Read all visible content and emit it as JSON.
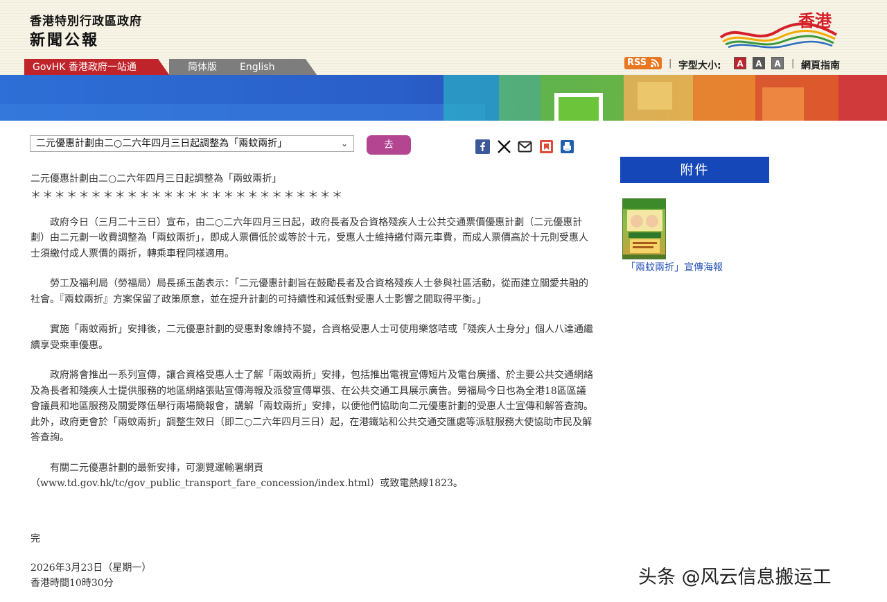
{
  "header": {
    "brand_line1": "香港特別行政區政府",
    "brand_line2": "新聞公報",
    "hk_brand": "香港",
    "nav": {
      "govhk": "GovHK 香港政府一站通",
      "simplified": "简体版",
      "english": "English"
    },
    "rss": "RSS",
    "font_size_label": "字型大小:",
    "font_size_options": [
      "A",
      "A",
      "A"
    ],
    "guide": "網頁指南"
  },
  "toolbar": {
    "select_value": "二元優惠計劃由二○二六年四月三日起調整為「兩蚊兩折」",
    "go_label": "去",
    "share_icons": [
      "facebook-icon",
      "x-icon",
      "email-icon",
      "bookmark-icon",
      "print-icon"
    ]
  },
  "article": {
    "headline": "二元優惠計劃由二○二六年四月三日起調整為「兩蚊兩折」",
    "stars": "＊＊＊＊＊＊＊＊＊＊＊＊＊＊＊＊＊＊＊＊＊＊＊＊＊＊",
    "paragraphs": [
      "政府今日（三月二十三日）宣布，由二○二六年四月三日起，政府長者及合資格殘疾人士公共交通票價優惠計劃（二元優惠計劃）由二元劃一收費調整為「兩蚊兩折」，即成人票價低於或等於十元，受惠人士維持繳付兩元車費，而成人票價高於十元則受惠人士須繳付成人票價的兩折，轉乘車程同樣適用。",
      "勞工及福利局（勞福局）局長孫玉菡表示：「二元優惠計劃旨在鼓勵長者及合資格殘疾人士參與社區活動，從而建立關愛共融的社會。『兩蚊兩折』方案保留了政策原意，並在提升計劃的可持續性和減低對受惠人士影響之間取得平衡。」",
      "實施「兩蚊兩折」安排後，二元優惠計劃的受惠對象維持不變，合資格受惠人士可使用樂悠咭或「殘疾人士身分」個人八達通繼續享受乘車優惠。",
      "政府將會推出一系列宣傳，讓合資格受惠人士了解「兩蚊兩折」安排，包括推出電視宣傳短片及電台廣播、於主要公共交通網絡及為長者和殘疾人士提供服務的地區網絡張貼宣傳海報及派發宣傳單張、在公共交通工具展示廣告。勞福局今日也為全港18區區議會議員和地區服務及關愛隊伍舉行兩場簡報會，講解「兩蚊兩折」安排，以便他們協助向二元優惠計劃的受惠人士宣傳和解答查詢。此外，政府更會於「兩蚊兩折」調整生效日（即二○二六年四月三日）起，在港鐵站和公共交通交匯處等派駐服務大使協助市民及解答查詢。",
      "有關二元優惠計劃的最新安排，可瀏覽運輸署網頁（www.td.gov.hk/tc/gov_public_transport_fare_concession/index.html）或致電熱線1823。"
    ],
    "end_mark": "完",
    "date": "2026年3月23日（星期一）",
    "time": "香港時間10時30分"
  },
  "sidebar": {
    "attachment_header": "附件",
    "attachment_label": "「兩蚊兩折」宣傳海報"
  },
  "watermark": "头条 @风云信息搬运工",
  "colors": {
    "govhk_tab": "#c0242b",
    "lang_tab": "#7d7d7d",
    "go_button": "#b34591",
    "attachment_header": "#1547b8",
    "link": "#2a56b8",
    "rss": "#e87722",
    "header_bg": "#f7f4e6"
  }
}
